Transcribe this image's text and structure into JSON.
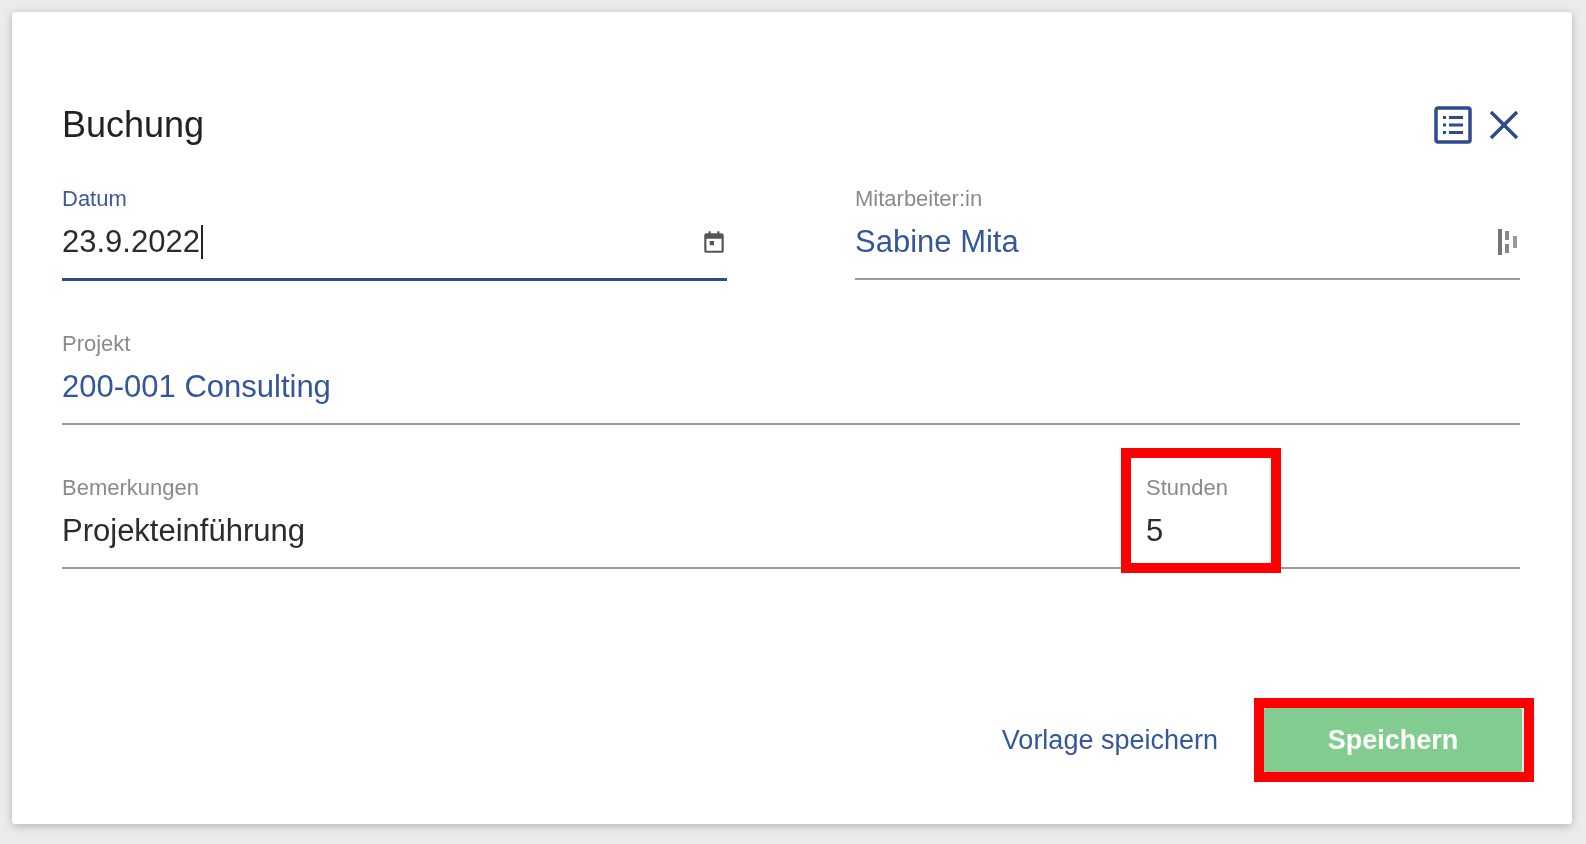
{
  "dialog": {
    "title": "Buchung"
  },
  "fields": [
    {
      "kind": "date",
      "label": "Datum",
      "value": "23.9.2022",
      "focused": true,
      "linked": false,
      "highlighted": false
    },
    {
      "kind": "lookup",
      "label": "Mitarbeiter:in",
      "value": "Sabine Mita",
      "focused": false,
      "linked": true,
      "highlighted": false
    },
    {
      "kind": "text",
      "label": "Projekt",
      "value": "200-001 Consulting",
      "focused": false,
      "linked": true,
      "highlighted": false
    },
    {
      "kind": "text",
      "label": "Bemerkungen",
      "value": "Projekteinführung",
      "focused": false,
      "linked": false,
      "highlighted": false
    },
    {
      "kind": "text",
      "label": "Stunden",
      "value": "5",
      "focused": false,
      "linked": false,
      "highlighted": true
    }
  ],
  "buttons": [
    {
      "kind": "text",
      "label": "Vorlage speichern",
      "highlighted": false
    },
    {
      "kind": "primary",
      "label": "Speichern",
      "highlighted": true
    }
  ]
}
